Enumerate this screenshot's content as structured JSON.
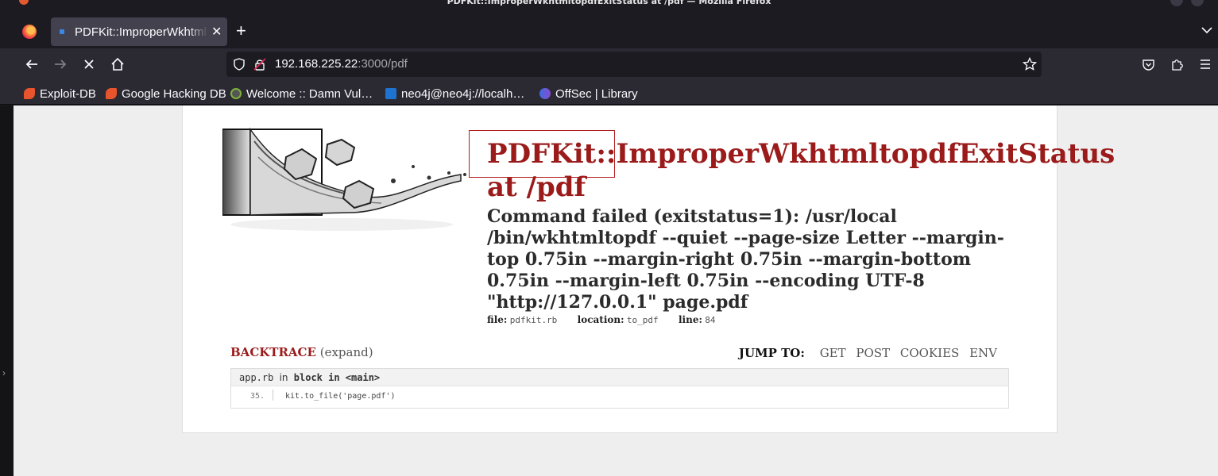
{
  "window": {
    "title": "PDFKit::ImproperWkhtmltopdfExitStatus at /pdf — Mozilla Firefox"
  },
  "tabs": [
    {
      "label": "PDFKit::ImproperWkhtmltopdfExitStatus at /pdf"
    }
  ],
  "address_bar": {
    "host": "192.168.225.22",
    "path": ":3000/pdf"
  },
  "bookmarks": [
    {
      "label": "Exploit-DB",
      "color": "#e8542c"
    },
    {
      "label": "Google Hacking DB",
      "color": "#e8542c"
    },
    {
      "label": "Welcome :: Damn Vul…",
      "color": "#7fb33a"
    },
    {
      "label": "neo4j@neo4j://localh…",
      "color": "#1e73d0"
    },
    {
      "label": "OffSec | Library",
      "color": "#6a5acd"
    }
  ],
  "error_page": {
    "title_line1": "PDFKit::ImproperWkhtmltopdfExitStatus",
    "title_line2": "at /pdf",
    "message": "Command failed (exitstatus=1): /usr/local /bin/wkhtmltopdf --quiet --page-size Letter --margin-top 0.75in --margin-right 0.75in --margin-bottom 0.75in --margin-left 0.75in --encoding UTF-8 \"http://127.0.0.1\" page.pdf",
    "file_label": "file:",
    "file_value": "pdfkit.rb",
    "location_label": "location:",
    "location_value": "to_pdf",
    "line_label": "line:",
    "line_value": "84",
    "backtrace_label": "BACKTRACE",
    "expand_label": "(expand)",
    "jump_to_label": "JUMP TO:",
    "jump_links": [
      "GET",
      "POST",
      "COOKIES",
      "ENV"
    ],
    "frame": {
      "file": "app.rb",
      "in_text": "in",
      "context": "block in <main>",
      "line_number": "35.",
      "source": "kit.to_file('page.pdf')"
    }
  },
  "colors": {
    "accent": "#9b1b1b",
    "chrome_dark": "#1c1b22",
    "toolbar": "#2b2a33"
  },
  "icons": [
    "firefox-logo-icon",
    "back-icon",
    "forward-icon",
    "stop-icon",
    "home-icon",
    "shield-icon",
    "lock-icon",
    "bookmark-star-icon",
    "pocket-icon",
    "extensions-icon",
    "menu-icon",
    "new-tab-icon",
    "tab-list-icon",
    "tab-close-icon"
  ]
}
